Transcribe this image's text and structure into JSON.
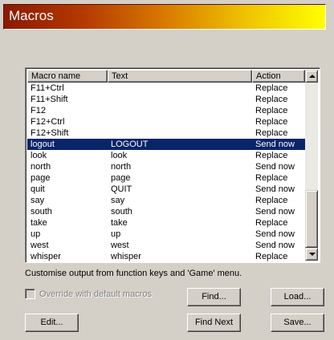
{
  "window": {
    "title": "Macros"
  },
  "table": {
    "columns": [
      "Macro name",
      "Text",
      "Action"
    ],
    "rows": [
      {
        "name": "F11+Ctrl",
        "text": "",
        "action": "Replace"
      },
      {
        "name": "F11+Shift",
        "text": "",
        "action": "Replace"
      },
      {
        "name": "F12",
        "text": "",
        "action": "Replace"
      },
      {
        "name": "F12+Ctrl",
        "text": "",
        "action": "Replace"
      },
      {
        "name": "F12+Shift",
        "text": "",
        "action": "Replace"
      },
      {
        "name": "logout",
        "text": "LOGOUT",
        "action": "Send now",
        "selected": true
      },
      {
        "name": "look",
        "text": "look",
        "action": "Replace"
      },
      {
        "name": "north",
        "text": "north",
        "action": "Send now"
      },
      {
        "name": "page",
        "text": "page",
        "action": "Replace"
      },
      {
        "name": "quit",
        "text": "QUIT",
        "action": "Send now"
      },
      {
        "name": "say",
        "text": "say",
        "action": "Replace"
      },
      {
        "name": "south",
        "text": "south",
        "action": "Send now"
      },
      {
        "name": "take",
        "text": "take",
        "action": "Replace"
      },
      {
        "name": "up",
        "text": "up",
        "action": "Send now"
      },
      {
        "name": "west",
        "text": "west",
        "action": "Send now"
      },
      {
        "name": "whisper",
        "text": "whisper",
        "action": "Replace"
      }
    ]
  },
  "hint": "Customise output from function keys and 'Game' menu.",
  "override_label": "Override with default macros",
  "buttons": {
    "find": "Find...",
    "load": "Load...",
    "edit": "Edit...",
    "find_next": "Find Next",
    "save": "Save..."
  }
}
